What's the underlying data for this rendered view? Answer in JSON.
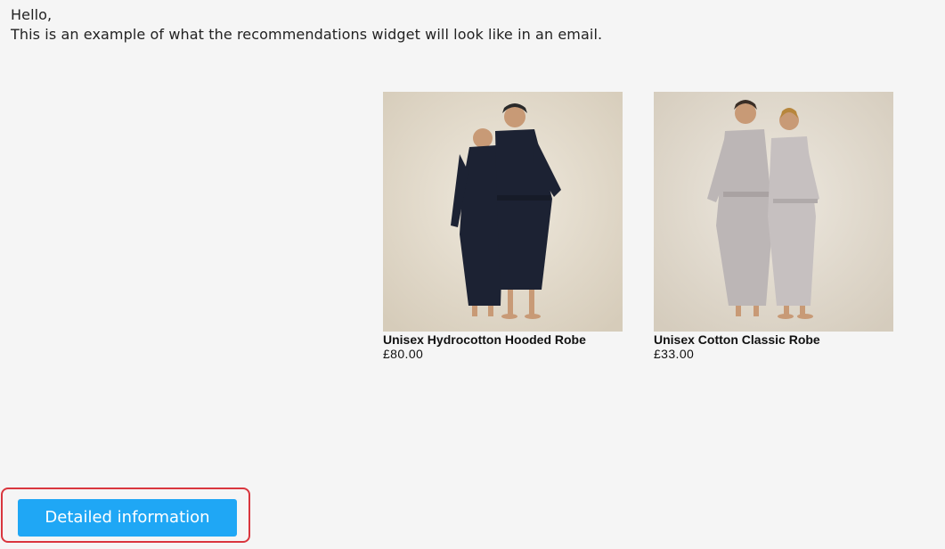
{
  "email": {
    "greeting_line1": "Hello,",
    "greeting_line2": "This is an example of what the recommendations widget will look like in an email."
  },
  "products": [
    {
      "name": "Unisex Hydrocotton Hooded Robe",
      "price": "£80.00",
      "image_desc": "two-people-in-navy-hooded-robes"
    },
    {
      "name": "Unisex Cotton Classic Robe",
      "price": "£33.00",
      "image_desc": "two-people-in-grey-classic-robes"
    }
  ],
  "cta": {
    "label": "Detailed information"
  },
  "colors": {
    "background": "#f5f5f5",
    "button": "#1fa7f5",
    "highlight": "#d9363e",
    "robe_navy": "#1c2233",
    "robe_grey": "#bcb6b6",
    "photo_bg": "#e3dbcb"
  }
}
